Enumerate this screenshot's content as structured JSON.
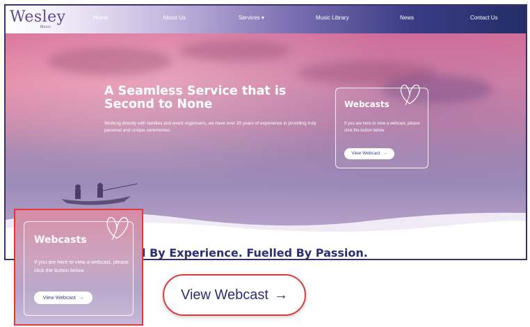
{
  "nav": {
    "logo": "Wesley",
    "logo_sub": "Music",
    "items": [
      {
        "label": "Home"
      },
      {
        "label": "About Us"
      },
      {
        "label": "Services ▾"
      },
      {
        "label": "Music Library"
      },
      {
        "label": "News"
      },
      {
        "label": "Contact Us"
      }
    ]
  },
  "hero": {
    "title": "A Seamless Service that is Second to None",
    "description": "Working directly with families and event organisers, we have over 20 years of experience in providing truly personal and unique ceremonies."
  },
  "webcast_card": {
    "title": "Webcasts",
    "description": "If you are here to view a webcast, please click the button below",
    "button_label": "View Webcast"
  },
  "tagline": "d By Experience. Fuelled By Passion.",
  "zoom_button": {
    "label": "View Webcast"
  },
  "colors": {
    "accent_dark": "#2c2f6f",
    "callout_red": "#e0383a"
  },
  "icons": {
    "arrow": "arrow-right-icon",
    "butterfly": "butterfly-icon"
  }
}
